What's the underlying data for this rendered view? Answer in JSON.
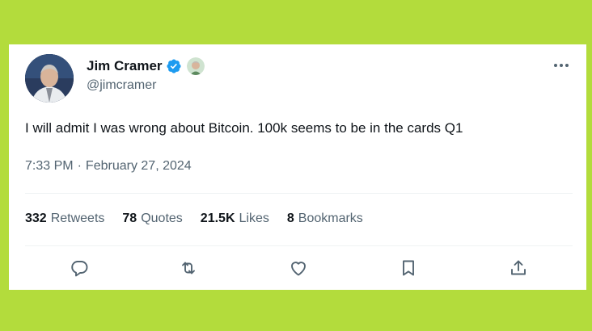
{
  "tweet": {
    "author": {
      "name": "Jim Cramer",
      "handle": "@jimcramer",
      "verified_icon": "verified-badge-icon",
      "badge_icon": "affiliate-avatar-icon"
    },
    "text": "I will admit I was wrong about Bitcoin. 100k seems to be in the cards Q1",
    "time": "7:33 PM",
    "separator": "·",
    "date": "February 27, 2024",
    "stats": {
      "retweets": {
        "count": "332",
        "label": "Retweets"
      },
      "quotes": {
        "count": "78",
        "label": "Quotes"
      },
      "likes": {
        "count": "21.5K",
        "label": "Likes"
      },
      "bookmarks": {
        "count": "8",
        "label": "Bookmarks"
      }
    },
    "actions": [
      "reply-icon",
      "retweet-icon",
      "like-icon",
      "bookmark-icon",
      "share-icon"
    ]
  },
  "colors": {
    "background": "#b3dc3c",
    "card": "#ffffff",
    "verified": "#1d9bf0",
    "text_primary": "#0f1419",
    "text_secondary": "#536471"
  }
}
